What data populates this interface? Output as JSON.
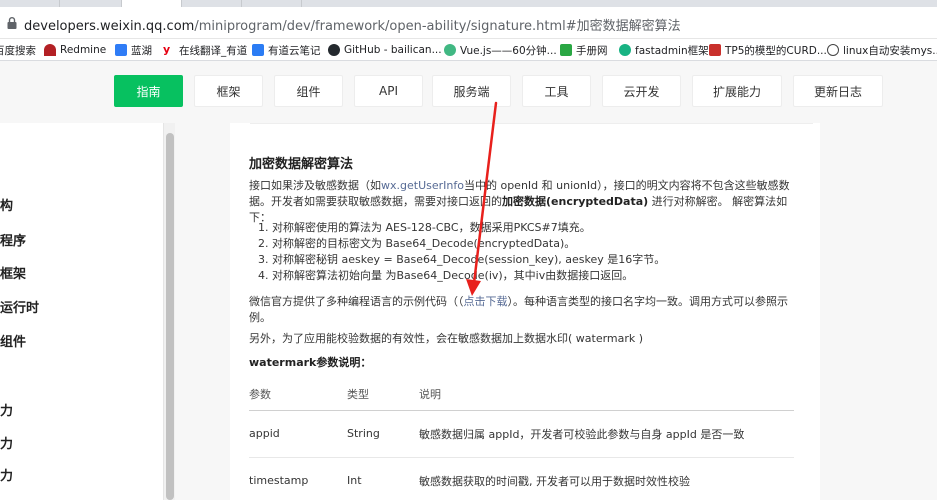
{
  "browser": {
    "url_host": "developers.weixin.qq.com",
    "url_path": "/miniprogram/dev/framework/open-ability/signature.html#加密数据解密算法"
  },
  "bookmarks": [
    {
      "label": "百度搜索",
      "color": "#2b5fde"
    },
    {
      "label": "Redmine",
      "color": "#b32024"
    },
    {
      "label": "蓝湖",
      "color": "#2f7cf6"
    },
    {
      "label": "在线翻译_有道",
      "color": "#e60012"
    },
    {
      "label": "有道云笔记",
      "color": "#2b7cf4"
    },
    {
      "label": "GitHub - bailican...",
      "color": "#24292e"
    },
    {
      "label": "Vue.js——60分钟...",
      "color": "#41b883"
    },
    {
      "label": "手册网",
      "color": "#2aa744"
    },
    {
      "label": "fastadmin框架",
      "color": "#18b383"
    },
    {
      "label": "TP5的模型的CURD...",
      "color": "#c9302c"
    },
    {
      "label": "linux自动安装mys...",
      "color": "#444444"
    }
  ],
  "nav": {
    "items": [
      "指南",
      "框架",
      "组件",
      "API",
      "服务端",
      "工具",
      "云开发",
      "扩展能力",
      "更新日志"
    ],
    "active_index": 0
  },
  "sidebar": {
    "items": [
      "构",
      "程序",
      "框架",
      "运行时",
      "组件",
      "力",
      "力",
      "力"
    ]
  },
  "content": {
    "heading": "加密数据解密算法",
    "p1_a": "接口如果涉及敏感数据（如",
    "p1_link": "wx.getUserInfo",
    "p1_b": "当中的 openId 和 unionId），接口的明文内容将不包含这些敏感数据。开发者如需要获取敏感数据，需要对接口返回的",
    "p1_bold": "加密数据(encryptedData)",
    "p1_c": " 进行对称解密。 解密算法如下：",
    "steps": [
      "1. 对称解密使用的算法为 AES-128-CBC，数据采用PKCS#7填充。",
      "2. 对称解密的目标密文为 Base64_Decode(encryptedData)。",
      "3. 对称解密秘钥 aeskey = Base64_Decode(session_key), aeskey 是16字节。",
      "4. 对称解密算法初始向量 为Base64_Decode(iv)，其中iv由数据接口返回。"
    ],
    "p2_a": "微信官方提供了多种编程语言的示例代码（（",
    "p2_link": "点击下载",
    "p2_b": "）。每种语言类型的接口名字均一致。调用方式可以参照示例。",
    "p3": "另外，为了应用能校验数据的有效性，会在敏感数据加上数据水印( watermark )",
    "wm_title": "watermark参数说明："
  },
  "table": {
    "headers": [
      "参数",
      "类型",
      "说明"
    ],
    "rows": [
      [
        "appid",
        "String",
        "敏感数据归属 appId，开发者可校验此参数与自身 appId 是否一致"
      ],
      [
        "timestamp",
        "Int",
        "敏感数据获取的时间戳, 开发者可以用于数据时效性校验"
      ]
    ]
  },
  "colors": {
    "accent": "#07c160",
    "link": "#576b95",
    "annotation": "#e8201c"
  }
}
